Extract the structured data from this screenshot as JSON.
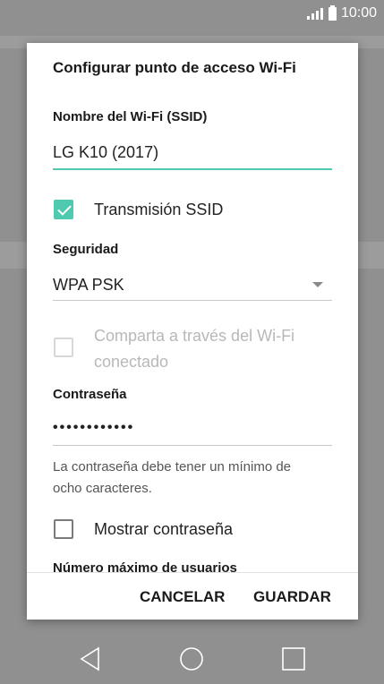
{
  "status_bar": {
    "time": "10:00"
  },
  "dialog": {
    "title": "Configurar punto de acceso Wi-Fi",
    "ssid": {
      "label": "Nombre del Wi-Fi (SSID)",
      "value": "LG K10 (2017)"
    },
    "broadcast_ssid": {
      "label": "Transmisión SSID",
      "checked": true
    },
    "security": {
      "label": "Seguridad",
      "value": "WPA PSK"
    },
    "share_via_wifi": {
      "label_line1": "Comparta a través del Wi-Fi",
      "label_line2": "conectado",
      "checked": false,
      "enabled": false
    },
    "password": {
      "label": "Contraseña",
      "value": "••••••••••••",
      "helper_line1": "La contraseña debe tener un mínimo de",
      "helper_line2": "ocho caracteres."
    },
    "show_password": {
      "label": "Mostrar contraseña",
      "checked": false
    },
    "max_users": {
      "label": "Número máximo de usuarios"
    },
    "buttons": {
      "cancel": "CANCELAR",
      "save": "GUARDAR"
    }
  },
  "colors": {
    "accent": "#4fc9b0",
    "scrim": "#909090"
  },
  "icons": {
    "signal": "signal-icon",
    "battery": "battery-icon",
    "back": "back-icon",
    "home": "home-icon",
    "recents": "recents-icon",
    "dropdown": "chevron-down-icon"
  }
}
